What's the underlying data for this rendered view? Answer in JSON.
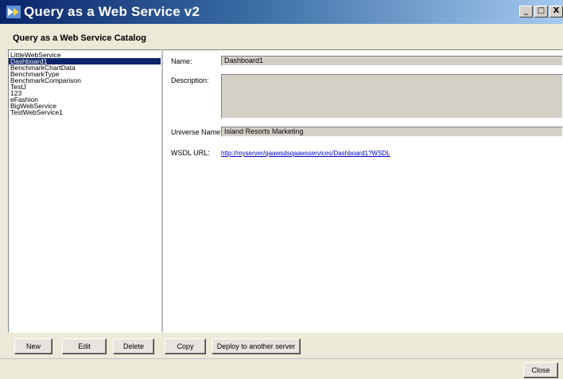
{
  "window": {
    "title": "Query as a Web Service v2",
    "minimize_glyph": "_",
    "maximize_glyph": "□",
    "close_glyph": "X"
  },
  "catalog": {
    "label": "Query as a Web Service Catalog",
    "items": [
      "LittleWebService",
      "Dashboard1",
      "BenchmarkChartData",
      "BenchmarkType",
      "BenchmarkComparison",
      "TestJ",
      "123",
      "eFashion",
      "BigWebService",
      "TestWebService1"
    ],
    "selected_index": 1
  },
  "details": {
    "name_label": "Name:",
    "name_value": "Dashboard1",
    "description_label": "Description:",
    "description_value": "",
    "universe_label": "Universe Name:",
    "universe_value": "Island Resorts Marketing",
    "wsdl_label": "WSDL URL:",
    "wsdl_value": "http://myserver/qaawsdsqaawsservices/Dashboard1?WSDL"
  },
  "buttons": {
    "new": "New",
    "edit": "Edit",
    "delete": "Delete",
    "copy": "Copy",
    "deploy": "Deploy to another server",
    "close": "Close"
  }
}
